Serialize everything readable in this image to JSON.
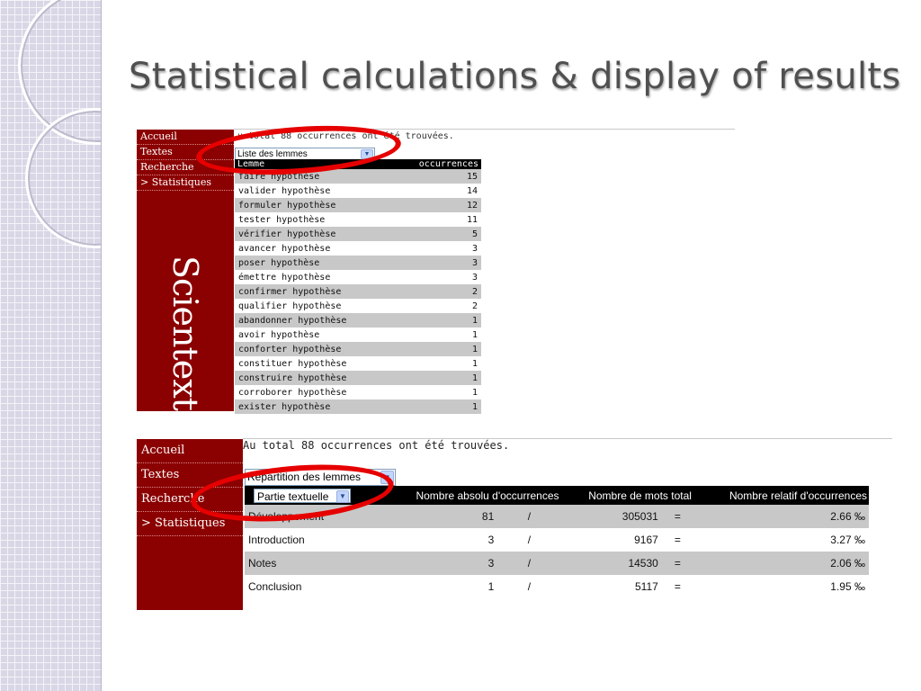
{
  "slide": {
    "title": "Statistical calculations & display of results"
  },
  "colors": {
    "brand_red": "#8b0000",
    "annotation_red": "#e60000",
    "row_gray": "#c8c8c8"
  },
  "top_screenshot": {
    "nav": [
      {
        "label": "Accueil"
      },
      {
        "label": "Textes"
      },
      {
        "label": "Recherche"
      },
      {
        "label": "> Statistiques"
      }
    ],
    "brand": "Scientext",
    "info_text": "u total 88 occurrences ont été trouvées.",
    "select_value": "Liste des lemmes",
    "table_headers": [
      "Lemme",
      "occurrences"
    ],
    "rows": [
      {
        "lemme": "faire hypothèse",
        "occ": "15"
      },
      {
        "lemme": "valider hypothèse",
        "occ": "14"
      },
      {
        "lemme": "formuler hypothèse",
        "occ": "12"
      },
      {
        "lemme": "tester hypothèse",
        "occ": "11"
      },
      {
        "lemme": "vérifier hypothèse",
        "occ": "5"
      },
      {
        "lemme": "avancer hypothèse",
        "occ": "3"
      },
      {
        "lemme": "poser hypothèse",
        "occ": "3"
      },
      {
        "lemme": "émettre hypothèse",
        "occ": "3"
      },
      {
        "lemme": "confirmer hypothèse",
        "occ": "2"
      },
      {
        "lemme": "qualifier hypothèse",
        "occ": "2"
      },
      {
        "lemme": "abandonner hypothèse",
        "occ": "1"
      },
      {
        "lemme": "avoir hypothèse",
        "occ": "1"
      },
      {
        "lemme": "conforter hypothèse",
        "occ": "1"
      },
      {
        "lemme": "constituer hypothèse",
        "occ": "1"
      },
      {
        "lemme": "construire hypothèse",
        "occ": "1"
      },
      {
        "lemme": "corroborer hypothèse",
        "occ": "1"
      },
      {
        "lemme": "exister hypothèse",
        "occ": "1"
      }
    ]
  },
  "bottom_screenshot": {
    "nav": [
      {
        "label": "Accueil"
      },
      {
        "label": "Textes"
      },
      {
        "label": "Recherche"
      },
      {
        "label": "> Statistiques"
      }
    ],
    "info_text": "Au total 88 occurrences ont été trouvées.",
    "select_value": "Répartition des lemmes",
    "column_select_value": "Partie textuelle",
    "table_headers": [
      "Nombre absolu d'occurrences",
      "Nombre de mots total",
      "Nombre relatif d'occurrences"
    ],
    "rows": [
      {
        "part": "Développement",
        "abs": "81",
        "sep": "/",
        "total": "305031",
        "eq": "=",
        "rel": "2.66 ‰"
      },
      {
        "part": "Introduction",
        "abs": "3",
        "sep": "/",
        "total": "9167",
        "eq": "=",
        "rel": "3.27 ‰"
      },
      {
        "part": "Notes",
        "abs": "3",
        "sep": "/",
        "total": "14530",
        "eq": "=",
        "rel": "2.06 ‰"
      },
      {
        "part": "Conclusion",
        "abs": "1",
        "sep": "/",
        "total": "5117",
        "eq": "=",
        "rel": "1.95 ‰"
      }
    ]
  }
}
